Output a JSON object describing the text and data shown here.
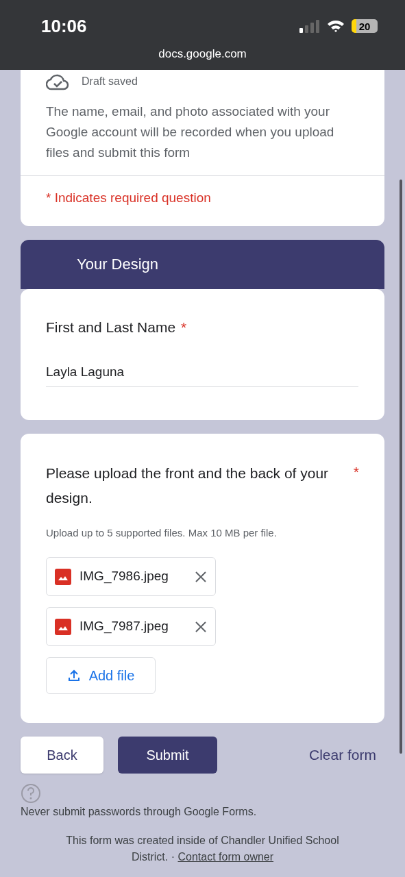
{
  "status_bar": {
    "time": "10:06",
    "battery": "20",
    "url": "docs.google.com"
  },
  "intro_card": {
    "draft_status": "Draft saved",
    "notice": "The name, email, and photo associated with your Google account will be recorded when you upload files and submit this form",
    "required_note": "* Indicates required question"
  },
  "section": {
    "title": "Your Design"
  },
  "questions": [
    {
      "kind": "text",
      "title": "First and Last Name",
      "required_mark": "*",
      "value": "Layla Laguna"
    },
    {
      "kind": "upload",
      "title": "Please upload the front and the back of your design.",
      "required_mark": "*",
      "hint": "Upload up to 5 supported files. Max 10 MB per file.",
      "files": [
        "IMG_7986.jpeg",
        "IMG_7987.jpeg"
      ],
      "add_label": "Add file"
    }
  ],
  "buttons": {
    "back": "Back",
    "submit": "Submit",
    "clear": "Clear form"
  },
  "footer": {
    "warning": "Never submit passwords through Google Forms.",
    "created": "This form was created inside of Chandler Unified School District.",
    "separator": "·",
    "link": "Contact form owner"
  }
}
